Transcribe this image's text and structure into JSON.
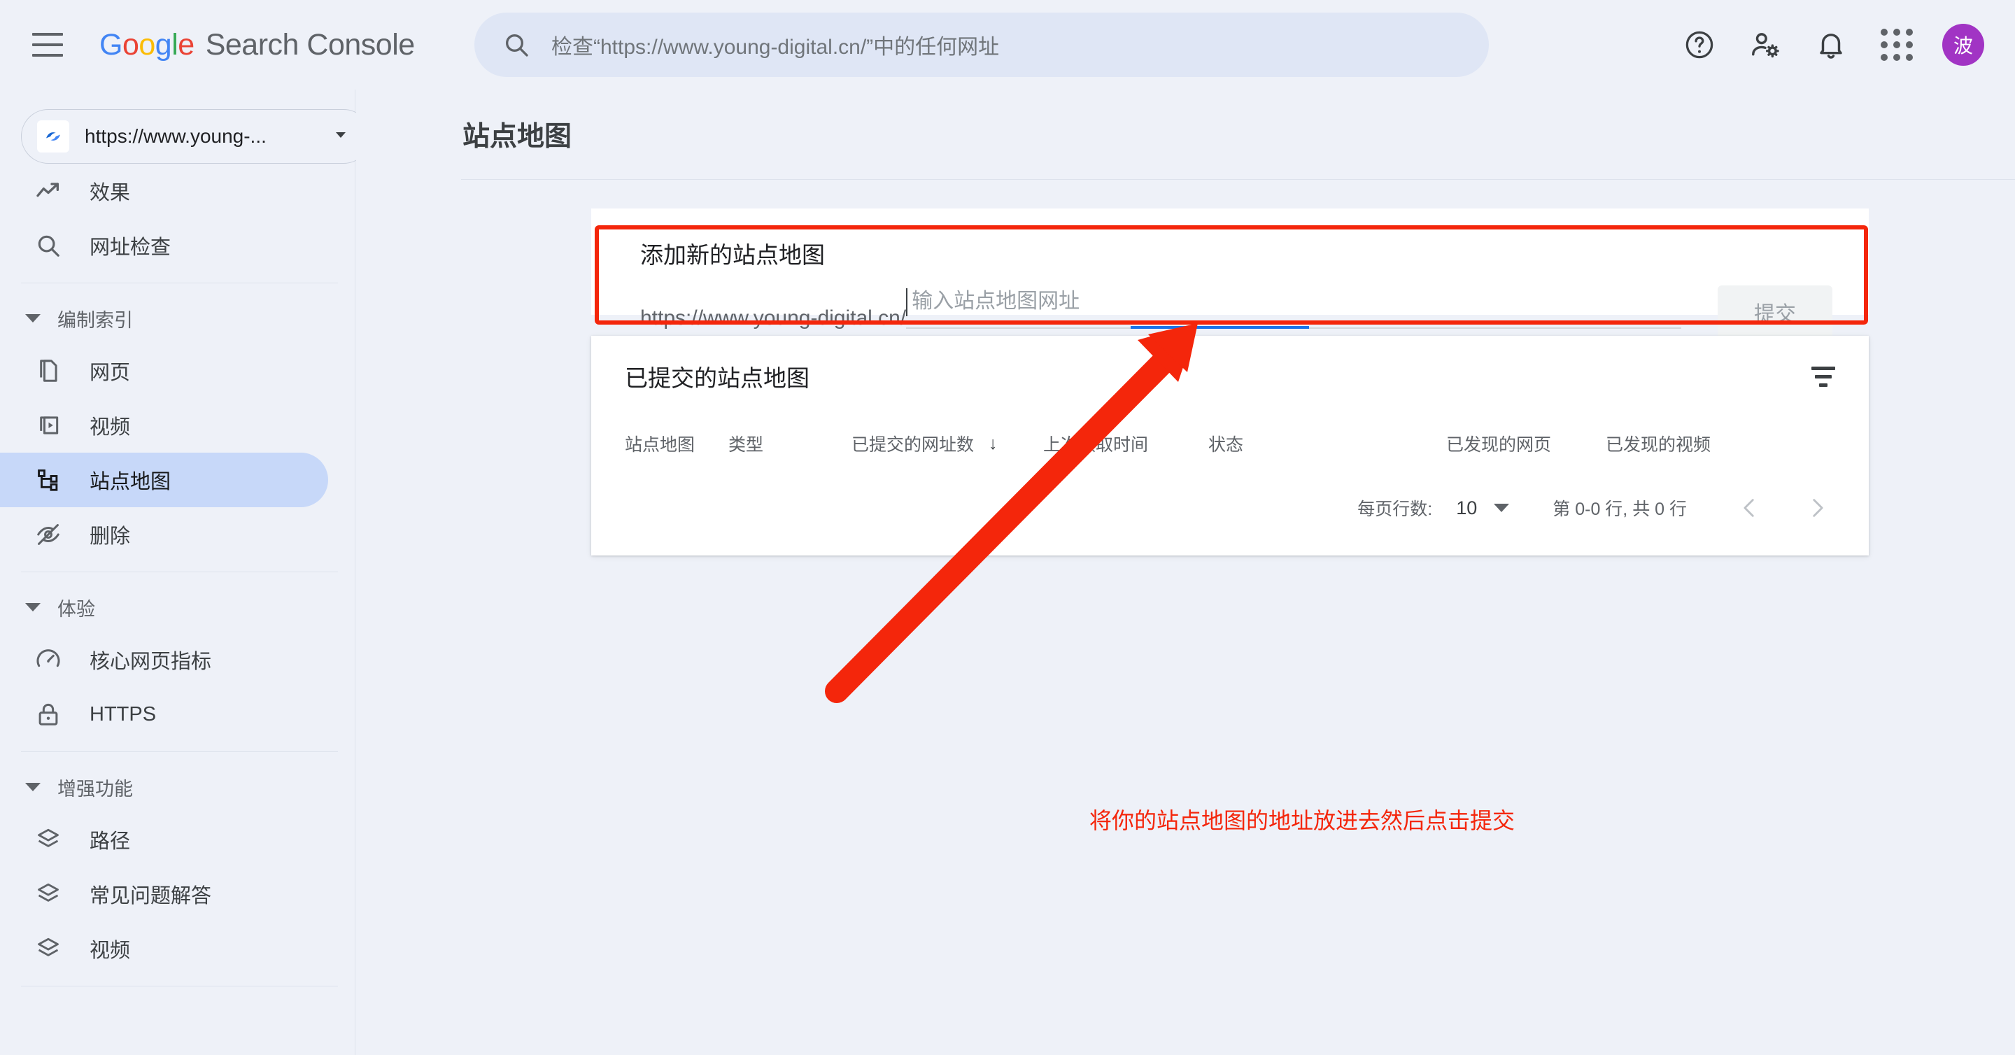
{
  "app": {
    "brand_google": "Google",
    "brand_product": "Search Console",
    "brand_letters": [
      "G",
      "o",
      "o",
      "g",
      "l",
      "e"
    ]
  },
  "search": {
    "placeholder": "检查“https://www.young-digital.cn/”中的任何网址",
    "icon": "search-icon"
  },
  "topbar": {
    "menu_icon": "hamburger-menu-icon",
    "help_icon": "help-circle-icon",
    "account_settings_icon": "person-gear-icon",
    "notifications_icon": "bell-icon",
    "apps_icon": "apps-grid-icon",
    "avatar_initial": "波",
    "avatar_color": "#a134c4"
  },
  "sidebar": {
    "property": {
      "label": "https://www.young-...",
      "favicon_icon": "site-favicon-icon",
      "caret_icon": "chevron-down-icon"
    },
    "top_items": [
      {
        "label": "效果",
        "icon": "trending-up-icon"
      },
      {
        "label": "网址检查",
        "icon": "search-icon"
      }
    ],
    "groups": [
      {
        "label": "编制索引",
        "caret_icon": "triangle-down-icon",
        "items": [
          {
            "label": "网页",
            "icon": "pages-icon",
            "active": false
          },
          {
            "label": "视频",
            "icon": "video-icon",
            "active": false
          },
          {
            "label": "站点地图",
            "icon": "sitemap-icon",
            "active": true
          },
          {
            "label": "删除",
            "icon": "eye-off-icon",
            "active": false
          }
        ]
      },
      {
        "label": "体验",
        "caret_icon": "triangle-down-icon",
        "items": [
          {
            "label": "核心网页指标",
            "icon": "speedometer-icon",
            "active": false
          },
          {
            "label": "HTTPS",
            "icon": "lock-icon",
            "active": false
          }
        ]
      },
      {
        "label": "增强功能",
        "caret_icon": "triangle-down-icon",
        "items": [
          {
            "label": "路径",
            "icon": "layers-icon",
            "active": false
          },
          {
            "label": "常见问题解答",
            "icon": "layers-icon",
            "active": false
          },
          {
            "label": "视频",
            "icon": "layers-icon",
            "active": false
          }
        ]
      }
    ]
  },
  "main": {
    "page_title": "站点地图",
    "add_card": {
      "title": "添加新的站点地图",
      "url_prefix": "https://www.young-digital.cn/",
      "input_placeholder": "输入站点地图网址",
      "input_value": "",
      "submit_label": "提交",
      "submit_disabled": true,
      "highlight_color": "#f4260b"
    },
    "table_card": {
      "title": "已提交的站点地图",
      "filter_icon": "filter-icon",
      "columns": [
        {
          "label": "站点地图",
          "sorted": false
        },
        {
          "label": "类型",
          "sorted": false
        },
        {
          "label": "已提交的网址数",
          "sorted": true,
          "sort_icon": "arrow-down-icon"
        },
        {
          "label": "上次读取时间",
          "sorted": false
        },
        {
          "label": "状态",
          "sorted": false
        },
        {
          "label": "已发现的网页",
          "sorted": false
        },
        {
          "label": "已发现的视频",
          "sorted": false
        }
      ],
      "rows": [],
      "pagination": {
        "rows_per_page_label": "每页行数:",
        "rows_per_page_value": "10",
        "caret_icon": "triangle-down-icon",
        "range_label": "第 0-0 行, 共 0 行",
        "prev_icon": "chevron-left-icon",
        "next_icon": "chevron-right-icon"
      }
    },
    "annotation": {
      "text": "将你的站点地图的地址放进去然后点击提交",
      "color": "#f4260b",
      "arrow_icon": "red-arrow-annotation"
    }
  }
}
